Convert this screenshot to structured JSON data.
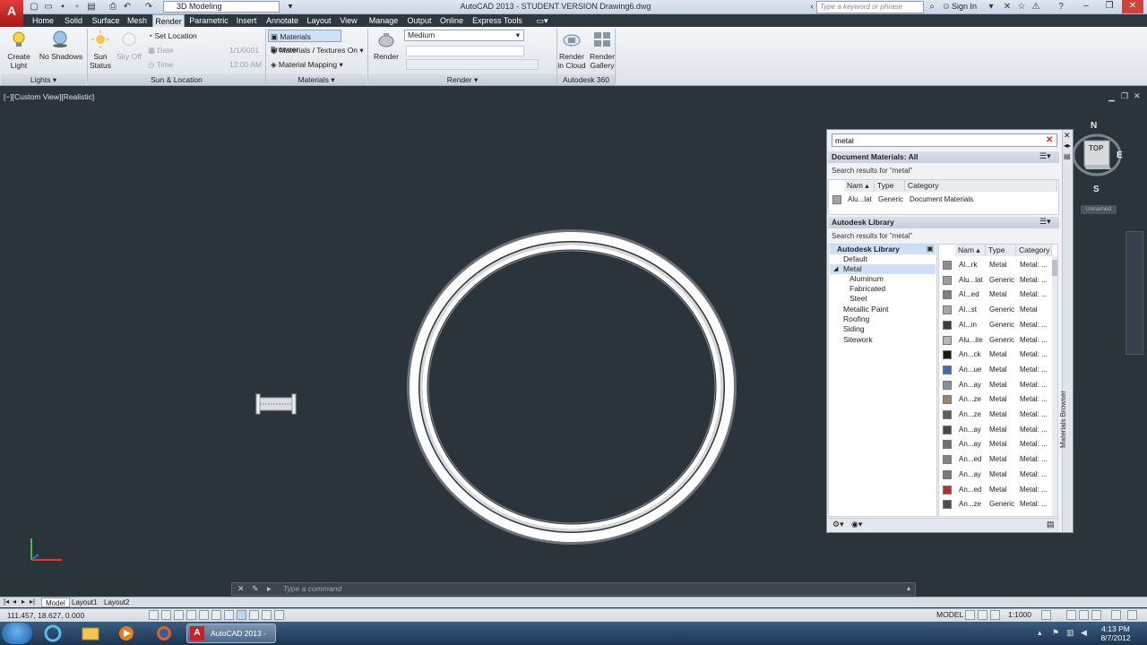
{
  "title_bar": {
    "workspace": "3D Modeling",
    "title": "AutoCAD 2013 - STUDENT VERSION    Drawing6.dwg",
    "search_placeholder": "Type a keyword or phrase",
    "sign_in": "Sign In"
  },
  "tabs": [
    "Home",
    "Solid",
    "Surface",
    "Mesh",
    "Render",
    "Parametric",
    "Insert",
    "Annotate",
    "Layout",
    "View",
    "Manage",
    "Output",
    "Online",
    "Express Tools"
  ],
  "active_tab": "Render",
  "ribbon": {
    "lights": {
      "create_light": "Create Light",
      "no_shadows": "No Shadows",
      "title": "Lights"
    },
    "sun": {
      "sun_status": "Sun Status",
      "sky_off": "Sky Off",
      "set_location": "Set Location",
      "date_label": "Date",
      "date_value": "1/1/0001",
      "time_label": "Time",
      "time_value": "12:00 AM",
      "title": "Sun & Location"
    },
    "materials": {
      "browser": "Materials Browser",
      "textures": "Materials / Textures On",
      "mapping": "Material Mapping",
      "title": "Materials"
    },
    "render": {
      "render_btn": "Render",
      "quality": "Medium",
      "title": "Render"
    },
    "cloud": {
      "render_cloud": "Render in Cloud",
      "render_gallery": "Render Gallery",
      "title": "Autodesk 360"
    }
  },
  "viewport": {
    "label": "[−][Custom View][Realistic]"
  },
  "materials_browser": {
    "search_value": "metal",
    "vertical_title": "Materials Browser",
    "doc_section": "Document Materials: All",
    "doc_results": "Search results for \"metal\"",
    "doc_columns": [
      "Nam",
      "Type",
      "Category"
    ],
    "doc_rows": [
      {
        "name": "Alu...lat",
        "type": "Generic",
        "category": "Document Materials"
      }
    ],
    "lib_section": "Autodesk Library",
    "lib_results": "Search results for \"metal\"",
    "tree": [
      "Autodesk Library",
      "Default",
      "Metal",
      "Aluminum",
      "Fabricated",
      "Steel",
      "Metallic Paint",
      "Roofing",
      "Siding",
      "Sitework"
    ],
    "lib_columns": [
      "Nam",
      "Type",
      "Category"
    ],
    "lib_rows": [
      {
        "name": "Al...rk",
        "type": "Metal",
        "category": "Metal: ...",
        "swatch": "#8a8f95"
      },
      {
        "name": "Alu...lat",
        "type": "Generic",
        "category": "Metal: ...",
        "swatch": "#9aa0a6"
      },
      {
        "name": "Al...ed",
        "type": "Metal",
        "category": "Metal: ...",
        "swatch": "#7c8187"
      },
      {
        "name": "Al...st",
        "type": "Generic",
        "category": "Metal",
        "swatch": "#a2a6ab"
      },
      {
        "name": "Al...in",
        "type": "Generic",
        "category": "Metal: ...",
        "swatch": "#3a3c40"
      },
      {
        "name": "Alu...ite",
        "type": "Generic",
        "category": "Metal: ...",
        "swatch": "#b4b8bc"
      },
      {
        "name": "An...ck",
        "type": "Metal",
        "category": "Metal: ...",
        "swatch": "#1a1a1a"
      },
      {
        "name": "An...ue",
        "type": "Metal",
        "category": "Metal: ...",
        "swatch": "#3a6fb5"
      },
      {
        "name": "An...ay",
        "type": "Metal",
        "category": "Metal: ...",
        "swatch": "#8c9096"
      },
      {
        "name": "An...ze",
        "type": "Metal",
        "category": "Metal: ...",
        "swatch": "#9c8468"
      },
      {
        "name": "An...ze",
        "type": "Metal",
        "category": "Metal: ...",
        "swatch": "#5b5f63"
      },
      {
        "name": "An...ay",
        "type": "Metal",
        "category": "Metal: ...",
        "swatch": "#45484c"
      },
      {
        "name": "An...ay",
        "type": "Metal",
        "category": "Metal: ...",
        "swatch": "#6e7277"
      },
      {
        "name": "An...ed",
        "type": "Metal",
        "category": "Metal: ...",
        "swatch": "#80858b"
      },
      {
        "name": "An...ay",
        "type": "Metal",
        "category": "Metal: ...",
        "swatch": "#74787d"
      },
      {
        "name": "An...ed",
        "type": "Metal",
        "category": "Metal: ...",
        "swatch": "#b8322a"
      },
      {
        "name": "An...ze",
        "type": "Generic",
        "category": "Metal: ...",
        "swatch": "#4a4d51"
      }
    ]
  },
  "viewcube": {
    "north": "N",
    "east": "E",
    "south": "S",
    "top": "TOP",
    "ucs": "Unnamed"
  },
  "command_line": {
    "placeholder": "Type a command"
  },
  "layout_tabs": [
    "Model",
    "Layout1",
    "Layout2"
  ],
  "status_bar": {
    "coords": "111.457, 18.627, 0.000",
    "model": "MODEL",
    "scale": "1:1000"
  },
  "taskbar": {
    "acad_label": "AutoCAD 2013 - S...",
    "time": "4:13 PM",
    "date": "8/7/2012"
  }
}
